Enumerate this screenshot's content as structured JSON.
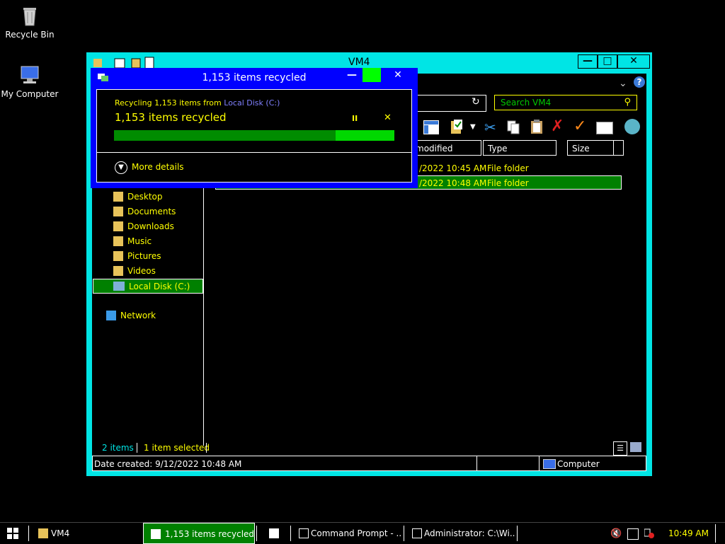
{
  "desktop": {
    "icons": [
      {
        "label": "Recycle Bin"
      },
      {
        "label": "My Computer"
      }
    ]
  },
  "explorer": {
    "title": "VM4",
    "search_placeholder": "Search VM4",
    "columns": {
      "modified": "modified",
      "type": "Type",
      "size": "Size"
    },
    "rows": [
      {
        "date": "/2022 10:45 AM",
        "type": "File folder"
      },
      {
        "date": "/2022 10:48 AM",
        "type": "File folder"
      }
    ],
    "nav": [
      "Desktop",
      "Documents",
      "Downloads",
      "Music",
      "Pictures",
      "Videos",
      "Local Disk (C:)",
      "Network"
    ],
    "status": {
      "items": "2 items",
      "selected": "1 item selected"
    },
    "details": {
      "created": "Date created: 9/12/2022 10:48 AM",
      "location": "Computer"
    }
  },
  "dialog": {
    "title": "1,153 items recycled",
    "recycling_prefix": "Recycling 1,153 items from",
    "source": "Local Disk (C:)",
    "headline": "1,153 items recycled",
    "progress": 0.79,
    "more_details": "More details"
  },
  "taskbar": {
    "items": [
      "VM4",
      "1,153 items recycled",
      "Command Prompt - ...",
      "Administrator: C:\\Wi..."
    ],
    "clock": "10:49 AM"
  },
  "colors": {
    "cyan_frame": "#00e5e5",
    "blue_frame": "#0000ff",
    "highlight": "#008000",
    "text_accent": "#ffff00"
  }
}
